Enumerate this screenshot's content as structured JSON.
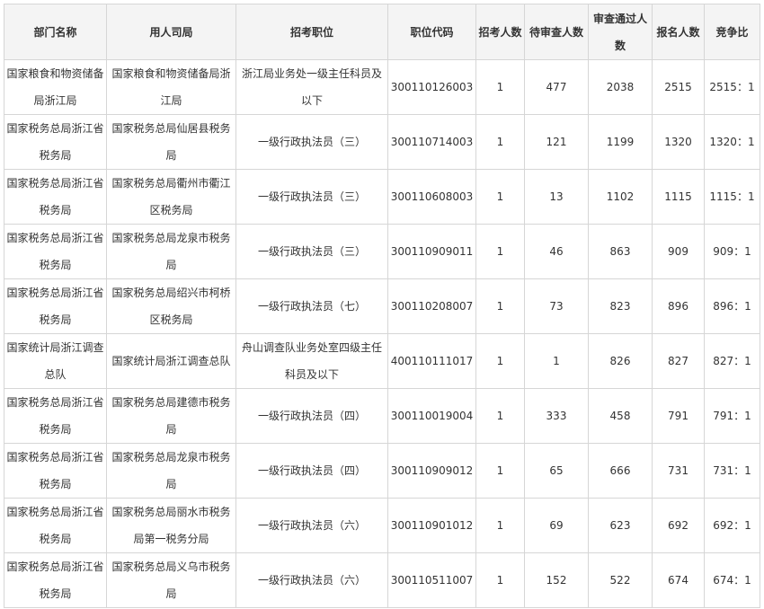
{
  "table": {
    "headers": [
      "部门名称",
      "用人司局",
      "招考职位",
      "职位代码",
      "招考人数",
      "待审查人数",
      "审查通过人数",
      "报名人数",
      "竞争比"
    ],
    "rows": [
      [
        "国家粮食和物资储备局浙江局",
        "国家粮食和物资储备局浙江局",
        "浙江局业务处一级主任科员及以下",
        "300110126003",
        "1",
        "477",
        "2038",
        "2515",
        "2515：1"
      ],
      [
        "国家税务总局浙江省税务局",
        "国家税务总局仙居县税务局",
        "一级行政执法员（三）",
        "300110714003",
        "1",
        "121",
        "1199",
        "1320",
        "1320：1"
      ],
      [
        "国家税务总局浙江省税务局",
        "国家税务总局衢州市衢江区税务局",
        "一级行政执法员（三）",
        "300110608003",
        "1",
        "13",
        "1102",
        "1115",
        "1115：1"
      ],
      [
        "国家税务总局浙江省税务局",
        "国家税务总局龙泉市税务局",
        "一级行政执法员（三）",
        "300110909011",
        "1",
        "46",
        "863",
        "909",
        "909：1"
      ],
      [
        "国家税务总局浙江省税务局",
        "国家税务总局绍兴市柯桥区税务局",
        "一级行政执法员（七）",
        "300110208007",
        "1",
        "73",
        "823",
        "896",
        "896：1"
      ],
      [
        "国家统计局浙江调查总队",
        "国家统计局浙江调查总队",
        "舟山调查队业务处室四级主任科员及以下",
        "400110111017",
        "1",
        "1",
        "826",
        "827",
        "827：1"
      ],
      [
        "国家税务总局浙江省税务局",
        "国家税务总局建德市税务局",
        "一级行政执法员（四）",
        "300110019004",
        "1",
        "333",
        "458",
        "791",
        "791：1"
      ],
      [
        "国家税务总局浙江省税务局",
        "国家税务总局龙泉市税务局",
        "一级行政执法员（四）",
        "300110909012",
        "1",
        "65",
        "666",
        "731",
        "731：1"
      ],
      [
        "国家税务总局浙江省税务局",
        "国家税务总局丽水市税务局第一税务分局",
        "一级行政执法员（六）",
        "300110901012",
        "1",
        "69",
        "623",
        "692",
        "692：1"
      ],
      [
        "国家税务总局浙江省税务局",
        "国家税务总局义乌市税务局",
        "一级行政执法员（六）",
        "300110511007",
        "1",
        "152",
        "522",
        "674",
        "674：1"
      ]
    ]
  }
}
